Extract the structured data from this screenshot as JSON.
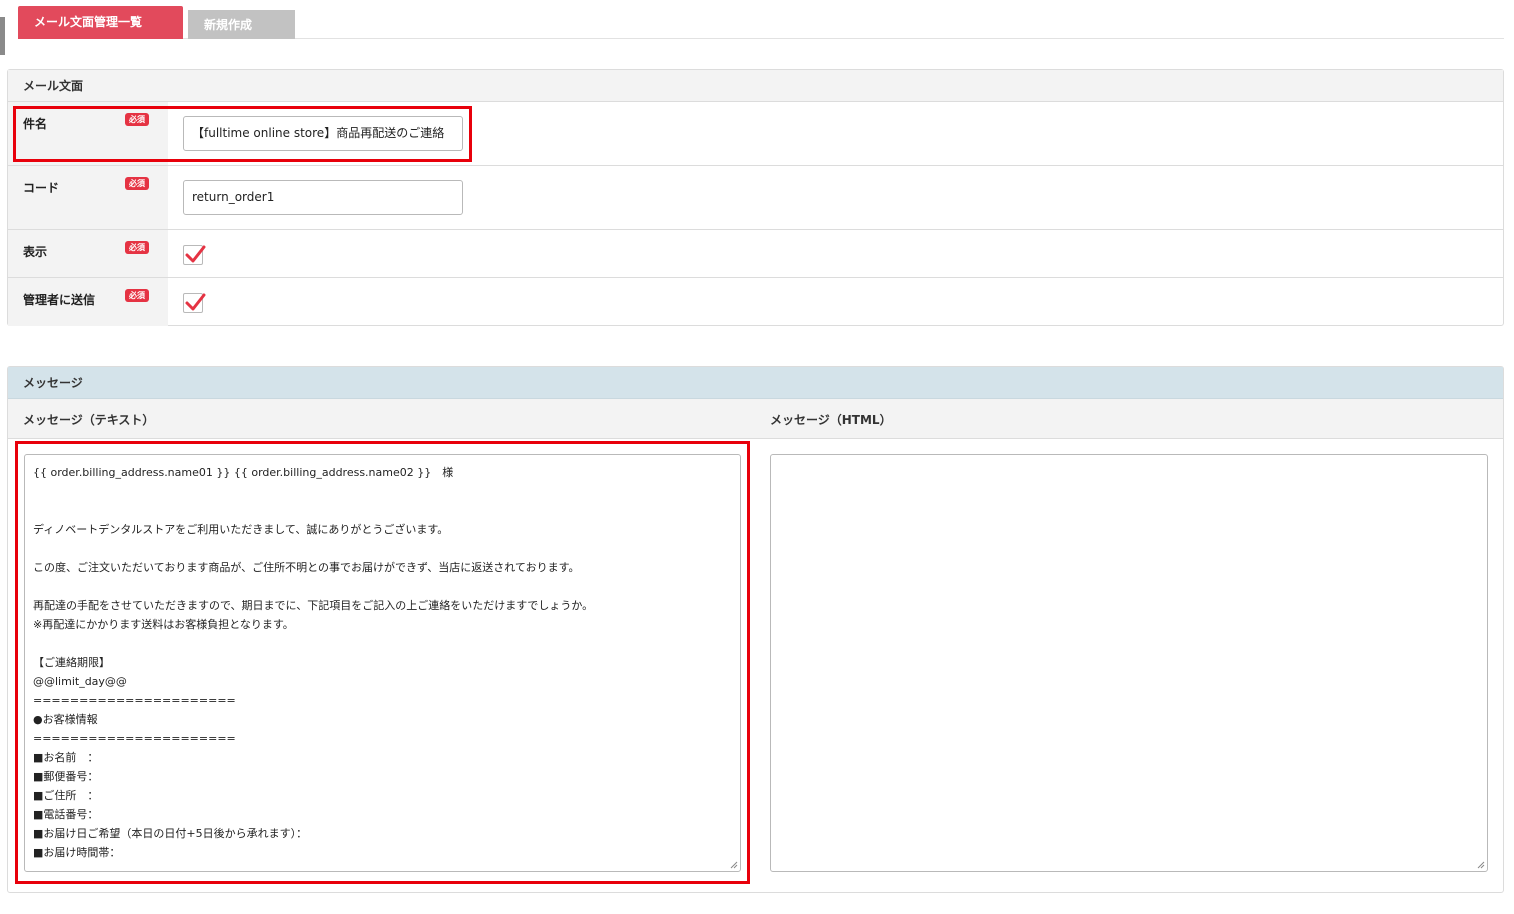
{
  "tabs": {
    "list": "メール文面管理一覧",
    "new": "新規作成"
  },
  "mail_panel": {
    "title": "メール文面",
    "required_badge": "必須",
    "subject": {
      "label": "件名",
      "value": "【fulltime online store】商品再配送のご連絡"
    },
    "code": {
      "label": "コード",
      "value": "return_order1"
    },
    "display": {
      "label": "表示",
      "checked": true
    },
    "send_admin": {
      "label": "管理者に送信",
      "checked": true
    }
  },
  "message_panel": {
    "title": "メッセージ",
    "text_label": "メッセージ（テキスト）",
    "html_label": "メッセージ（HTML）",
    "text_lines": [
      "{{ order.billing_address.name01 }} {{ order.billing_address.name02 }}　様",
      "",
      "",
      "ディノベートデンタルストアをご利用いただきまして、誠にありがとうございます。",
      "",
      "この度、ご注文いただいております商品が、ご住所不明との事でお届けができず、当店に返送されております。",
      "",
      "再配達の手配をさせていただきますので、期日までに、下記項目をご記入の上ご連絡をいただけますでしょうか。",
      "※再配達にかかります送料はお客様負担となります。",
      "",
      "【ご連絡期限】",
      "@@limit_day@@",
      "======================",
      "●お客様情報",
      "======================",
      "■お名前　：",
      "■郵便番号：",
      "■ご住所　：",
      "■電話番号：",
      "■お届け日ご希望（本日の日付+5日後から承れます）：",
      "■お届け時間帯：",
      "---------------------"
    ],
    "html_value": ""
  },
  "colors": {
    "tab_active": "#e24a5c",
    "tab_inactive": "#c2c2c2",
    "required_badge": "#e53343",
    "checkmark": "#e53343",
    "highlight": "#e8000b",
    "message_header": "#d4e3ea"
  }
}
